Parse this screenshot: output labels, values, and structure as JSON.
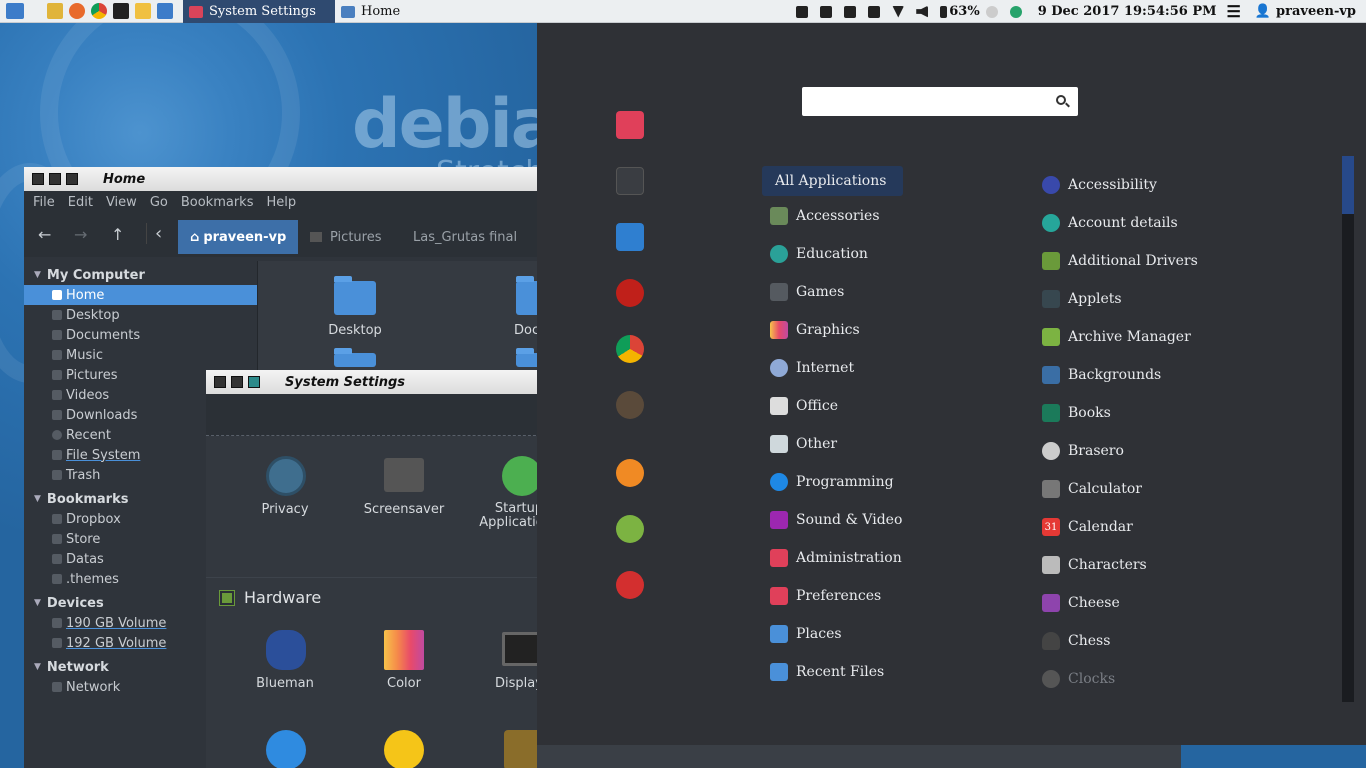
{
  "panel": {
    "tasks": [
      {
        "label": "System Settings",
        "active": true
      },
      {
        "label": "Home",
        "active": false
      }
    ],
    "battery": "63%",
    "clock": "9 Dec 2017 19:54:56 PM",
    "user": "praveen-vp"
  },
  "wallpaper": {
    "title": "debian",
    "subtitle": "Stretch"
  },
  "file_manager": {
    "title": "Home",
    "menu": [
      "File",
      "Edit",
      "View",
      "Go",
      "Bookmarks",
      "Help"
    ],
    "breadcrumbs": [
      "praveen-vp",
      "Pictures",
      "Las_Grutas final"
    ],
    "sections": [
      {
        "title": "My Computer",
        "items": [
          "Home",
          "Desktop",
          "Documents",
          "Music",
          "Pictures",
          "Videos",
          "Downloads",
          "Recent",
          "File System",
          "Trash"
        ]
      },
      {
        "title": "Bookmarks",
        "items": [
          "Dropbox",
          "Store",
          "Datas",
          ".themes"
        ]
      },
      {
        "title": "Devices",
        "items": [
          "190 GB Volume",
          "192 GB Volume"
        ]
      },
      {
        "title": "Network",
        "items": [
          "Network"
        ]
      }
    ],
    "selected": "Home",
    "files": [
      "Desktop",
      "Docum"
    ]
  },
  "system_settings": {
    "title": "System Settings",
    "top_items": [
      "Privacy",
      "Screensaver",
      "Startup Applications"
    ],
    "hardware_title": "Hardware",
    "hardware_items": [
      "Blueman",
      "Color",
      "Display"
    ]
  },
  "app_menu": {
    "search": {
      "placeholder": ""
    },
    "categories": [
      "All Applications",
      "Accessories",
      "Education",
      "Games",
      "Graphics",
      "Internet",
      "Office",
      "Other",
      "Programming",
      "Sound & Video",
      "Administration",
      "Preferences",
      "Places",
      "Recent Files"
    ],
    "applications": [
      "Accessibility",
      "Account details",
      "Additional Drivers",
      "Applets",
      "Archive Manager",
      "Backgrounds",
      "Books",
      "Brasero",
      "Calculator",
      "Calendar",
      "Characters",
      "Cheese",
      "Chess",
      "Clocks"
    ],
    "calendar_day": "31",
    "colors": {
      "accent": "#25395a",
      "menu_bg": "#2f3136",
      "selected": "#4a90d9"
    }
  }
}
